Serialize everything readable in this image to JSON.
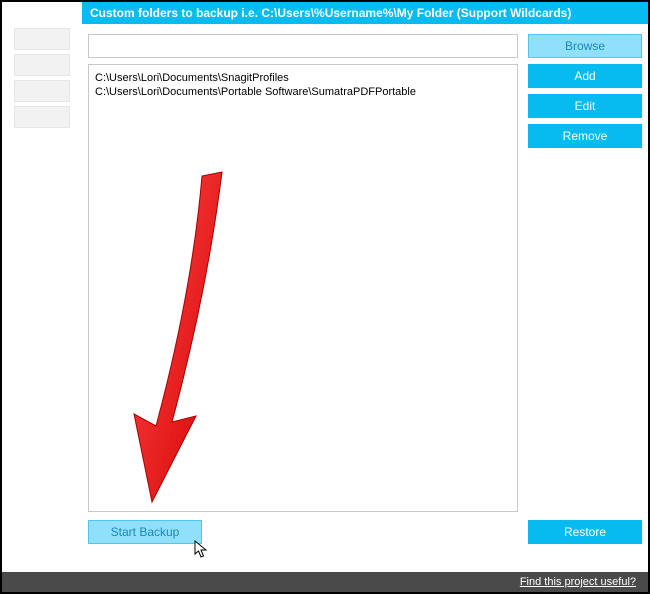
{
  "header": {
    "title": "Custom folders to backup i.e. C:\\Users\\%Username%\\My Folder (Support Wildcards)"
  },
  "input": {
    "value": ""
  },
  "list": {
    "items": [
      "C:\\Users\\Lori\\Documents\\SnagitProfiles",
      "C:\\Users\\Lori\\Documents\\Portable Software\\SumatraPDFPortable"
    ]
  },
  "buttons": {
    "browse": "Browse",
    "add": "Add",
    "edit": "Edit",
    "remove": "Remove",
    "start_backup": "Start Backup",
    "restore": "Restore"
  },
  "status": {
    "link": "Find this project useful?"
  }
}
